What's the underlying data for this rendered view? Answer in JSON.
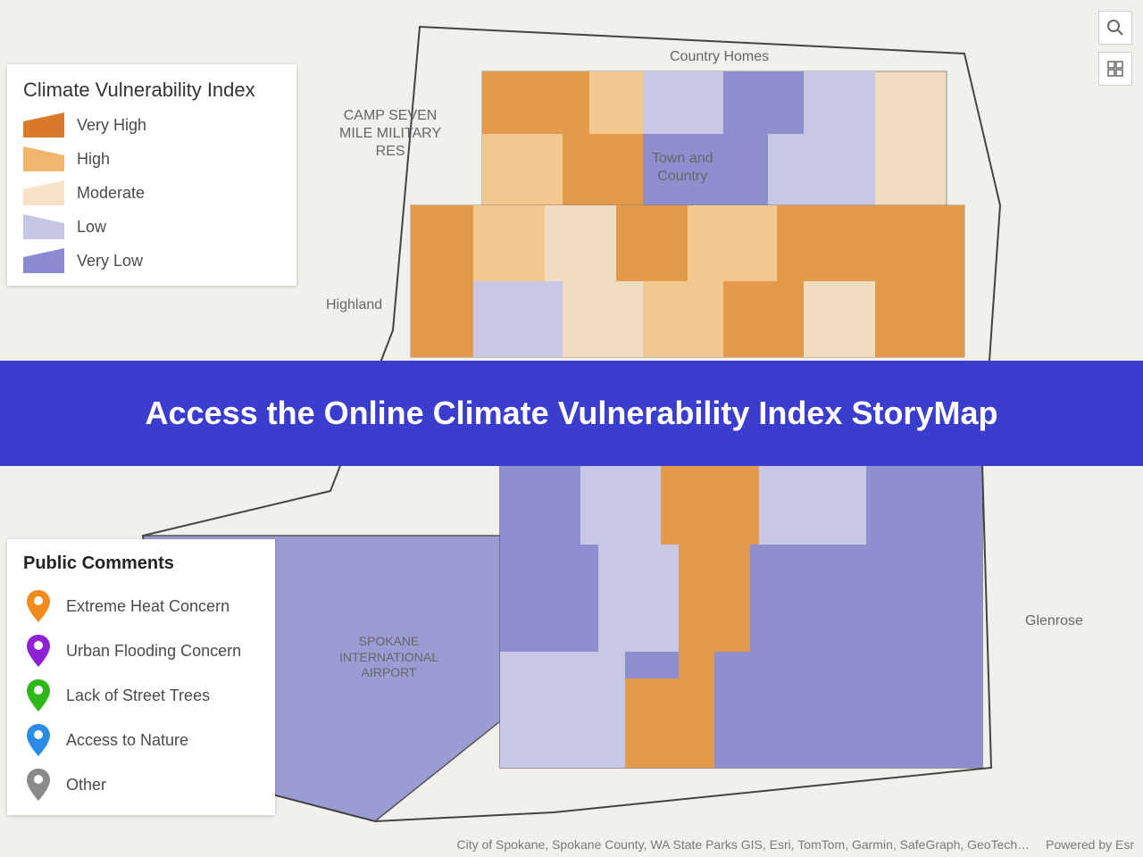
{
  "legend_cvi": {
    "title": "Climate Vulnerability Index",
    "items": [
      {
        "label": "Very High",
        "color": "#d97a2b"
      },
      {
        "label": "High",
        "color": "#f1b66d"
      },
      {
        "label": "Moderate",
        "color": "#f6e2c6"
      },
      {
        "label": "Low",
        "color": "#c7c6e6"
      },
      {
        "label": "Very Low",
        "color": "#8b8ccf"
      }
    ]
  },
  "legend_pc": {
    "title": "Public Comments",
    "items": [
      {
        "label": "Extreme Heat Concern",
        "color": "#f28a1c"
      },
      {
        "label": "Urban Flooding Concern",
        "color": "#9020d6"
      },
      {
        "label": "Lack of Street Trees",
        "color": "#2fb81a"
      },
      {
        "label": "Access to Nature",
        "color": "#2a8ce6"
      },
      {
        "label": "Other",
        "color": "#8a8a8a"
      }
    ]
  },
  "banner": {
    "text": "Access the Online Climate Vulnerability Index StoryMap"
  },
  "attribution": {
    "sources": "City of Spokane, Spokane County, WA State Parks GIS, Esri, TomTom, Garmin, SafeGraph, GeoTech…",
    "powered": "Powered by Esr"
  },
  "map_labels": {
    "camp_seven": "CAMP SEVEN\nMILE MILITARY\nRES",
    "country_homes": "Country Homes",
    "town_country": "Town and\nCountry",
    "highland": "Highland",
    "airport": "SPOKANE\nINTERNATIONAL\nAIRPORT",
    "glenrose": "Glenrose"
  }
}
